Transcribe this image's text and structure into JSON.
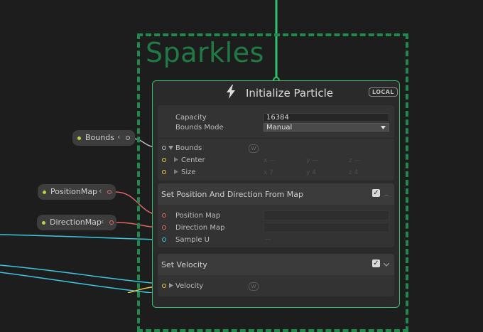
{
  "group": {
    "title": "Sparkles"
  },
  "context": {
    "title": "Initialize Particle",
    "space_badge": "LOCAL",
    "capacity_label": "Capacity",
    "capacity_value": "16384",
    "bounds_mode_label": "Bounds Mode",
    "bounds_mode_value": "Manual",
    "bounds_label": "Bounds",
    "center_label": "Center",
    "size_label": "Size",
    "w_badge": "W",
    "center_axes": [
      "x —",
      "y —",
      "z —"
    ],
    "size_axes": [
      "x 7",
      "y 4",
      "z 4"
    ]
  },
  "blocks": [
    {
      "title": "Set Position And Direction From Map",
      "enabled": true,
      "inputs": [
        "Position Map",
        "Direction Map",
        "Sample U"
      ],
      "sample_u_value": "—"
    },
    {
      "title": "Set Velocity",
      "enabled": true,
      "inputs": [
        "Velocity"
      ]
    }
  ],
  "properties": [
    {
      "label": "Bounds",
      "color": "#b7d34a"
    },
    {
      "label": "PositionMap",
      "color": "#b7d34a"
    },
    {
      "label": "DirectionMap",
      "color": "#b7d34a"
    }
  ],
  "colors": {
    "flow_green": "#2fc26b",
    "group_green": "#1f8a4c",
    "texture_port": "#e06666",
    "float_port": "#3ec6e0",
    "vector_port": "#e8d24a",
    "property_dot": "#b7d34a"
  },
  "icons": [
    "bolt-icon",
    "checkbox-icon",
    "chevron-down-icon",
    "chevron-left-icon",
    "triangle-right-icon"
  ]
}
